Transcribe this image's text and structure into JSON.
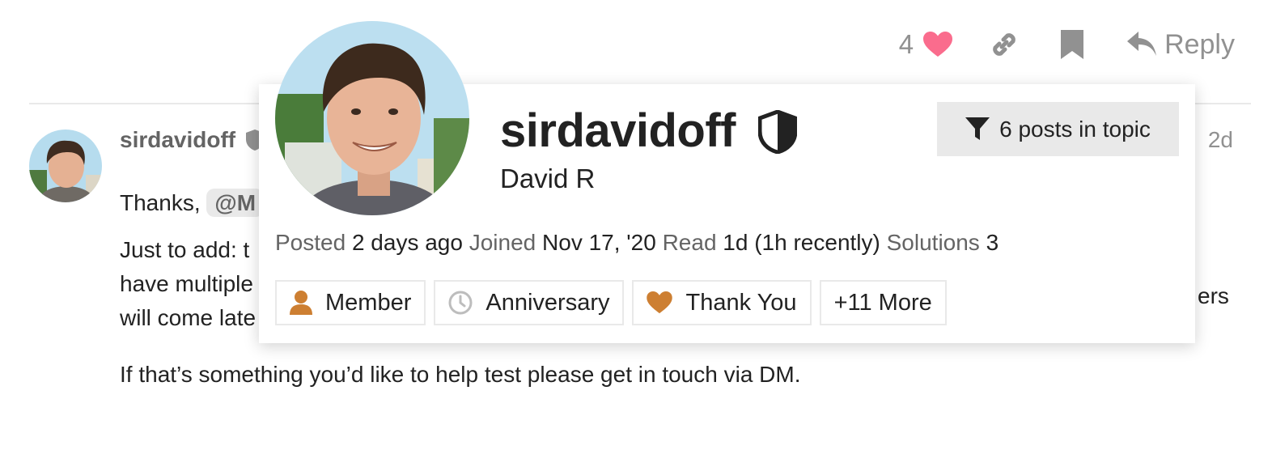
{
  "post_actions": {
    "like_count": "4",
    "reply_label": "Reply"
  },
  "post": {
    "username": "sirdavidoff",
    "date": "2d",
    "line1_prefix": "Thanks,",
    "mention": "@M",
    "line2": "Just to add: t",
    "line3": "have multiple",
    "line3_end": "ers",
    "line4": "will come late",
    "line5": "If that’s something you’d like to help test please get in touch via DM."
  },
  "user_card": {
    "username": "sirdavidoff",
    "full_name": "David R",
    "posts_in_topic": "6 posts in topic",
    "meta": [
      {
        "label": "Posted",
        "value": "2 days ago"
      },
      {
        "label": "Joined",
        "value": "Nov 17, '20"
      },
      {
        "label": "Read",
        "value": "1d (1h recently)"
      },
      {
        "label": "Solutions",
        "value": "3"
      }
    ],
    "badges": [
      {
        "label": "Member",
        "icon": "user-icon"
      },
      {
        "label": "Anniversary",
        "icon": "clock-icon"
      },
      {
        "label": "Thank You",
        "icon": "heart-icon"
      },
      {
        "label": "+11 More",
        "icon": ""
      }
    ]
  },
  "colors": {
    "heart": "#fa6c8d",
    "muted": "#919191",
    "badge_bronze": "#cd7f32",
    "chip_bg": "#e9e9e9"
  }
}
